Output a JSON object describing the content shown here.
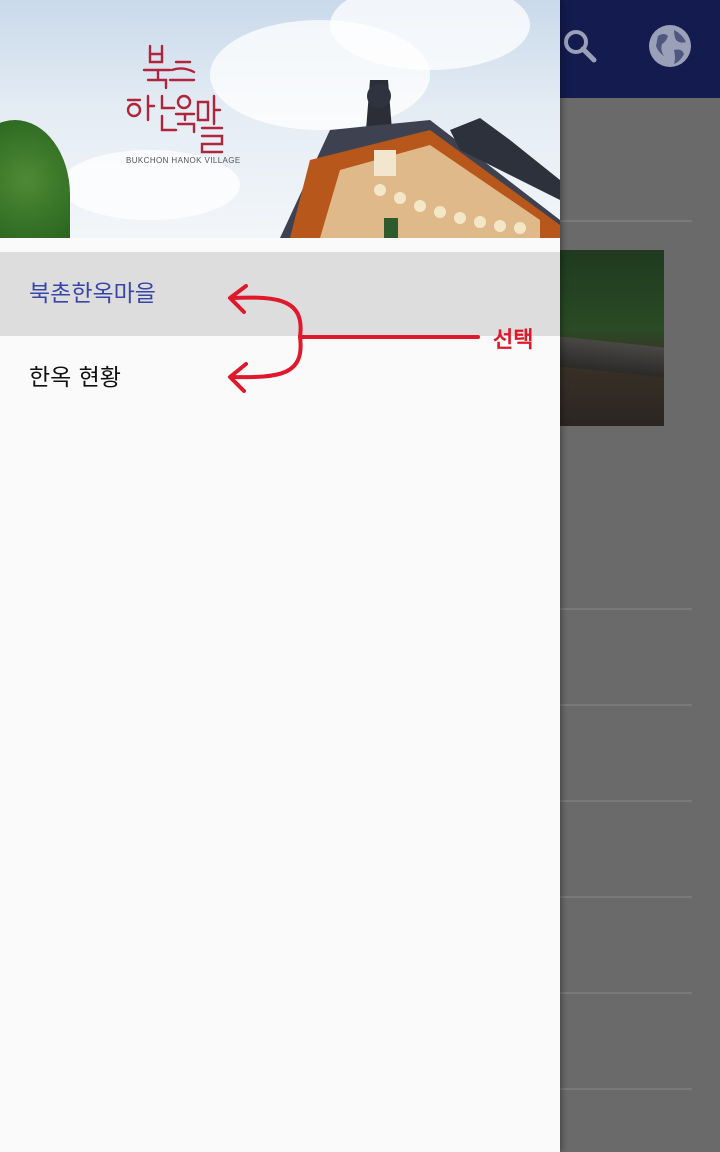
{
  "drawer": {
    "header": {
      "logo_text": "BUKCHON HANOK VILLAGE"
    },
    "items": [
      {
        "label": "북촌한옥마을",
        "selected": true
      },
      {
        "label": "한옥 현황",
        "selected": false
      }
    ]
  },
  "app_bar": {
    "icons": [
      "search-icon",
      "globe-icon"
    ],
    "color": "#131b4f"
  },
  "annotation": {
    "label": "선택",
    "color": "#e0182b"
  },
  "colors": {
    "selected_text": "#3846a8",
    "selected_bg": "#dddddd",
    "logo": "#b0253c"
  }
}
